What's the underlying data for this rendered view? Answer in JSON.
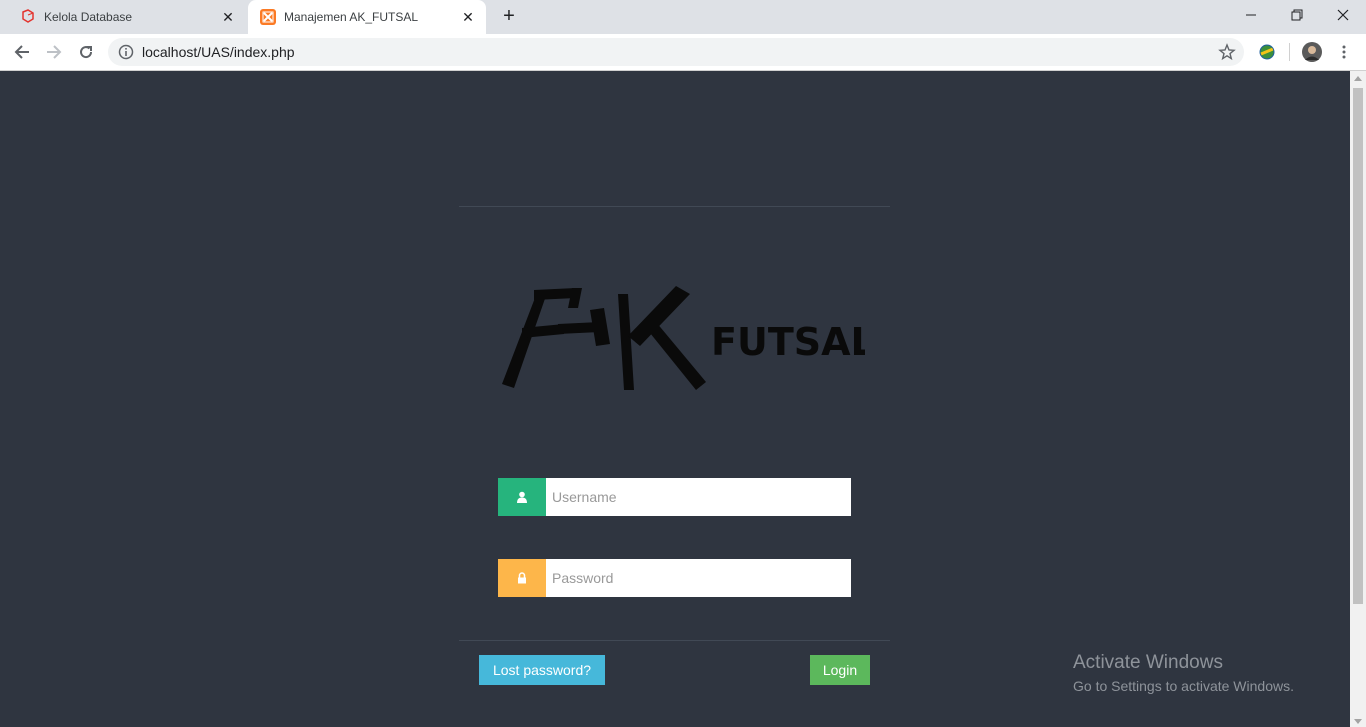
{
  "browser": {
    "tabs": [
      {
        "title": "Kelola Database",
        "icon": "laravel-icon",
        "active": false
      },
      {
        "title": "Manajemen AK_FUTSAL",
        "icon": "xampp-icon",
        "active": true
      }
    ],
    "url": "localhost/UAS/index.php"
  },
  "login": {
    "logo_text": "FUTSAL",
    "username_placeholder": "Username",
    "password_placeholder": "Password",
    "lost_password_label": "Lost password?",
    "login_label": "Login"
  },
  "colors": {
    "page_bg": "#2f3540",
    "user_addon": "#26b47d",
    "lock_addon": "#fdb64a",
    "lost_btn": "#46b8da",
    "login_btn": "#5cb85c"
  },
  "watermark": {
    "line1": "Activate Windows",
    "line2": "Go to Settings to activate Windows."
  }
}
